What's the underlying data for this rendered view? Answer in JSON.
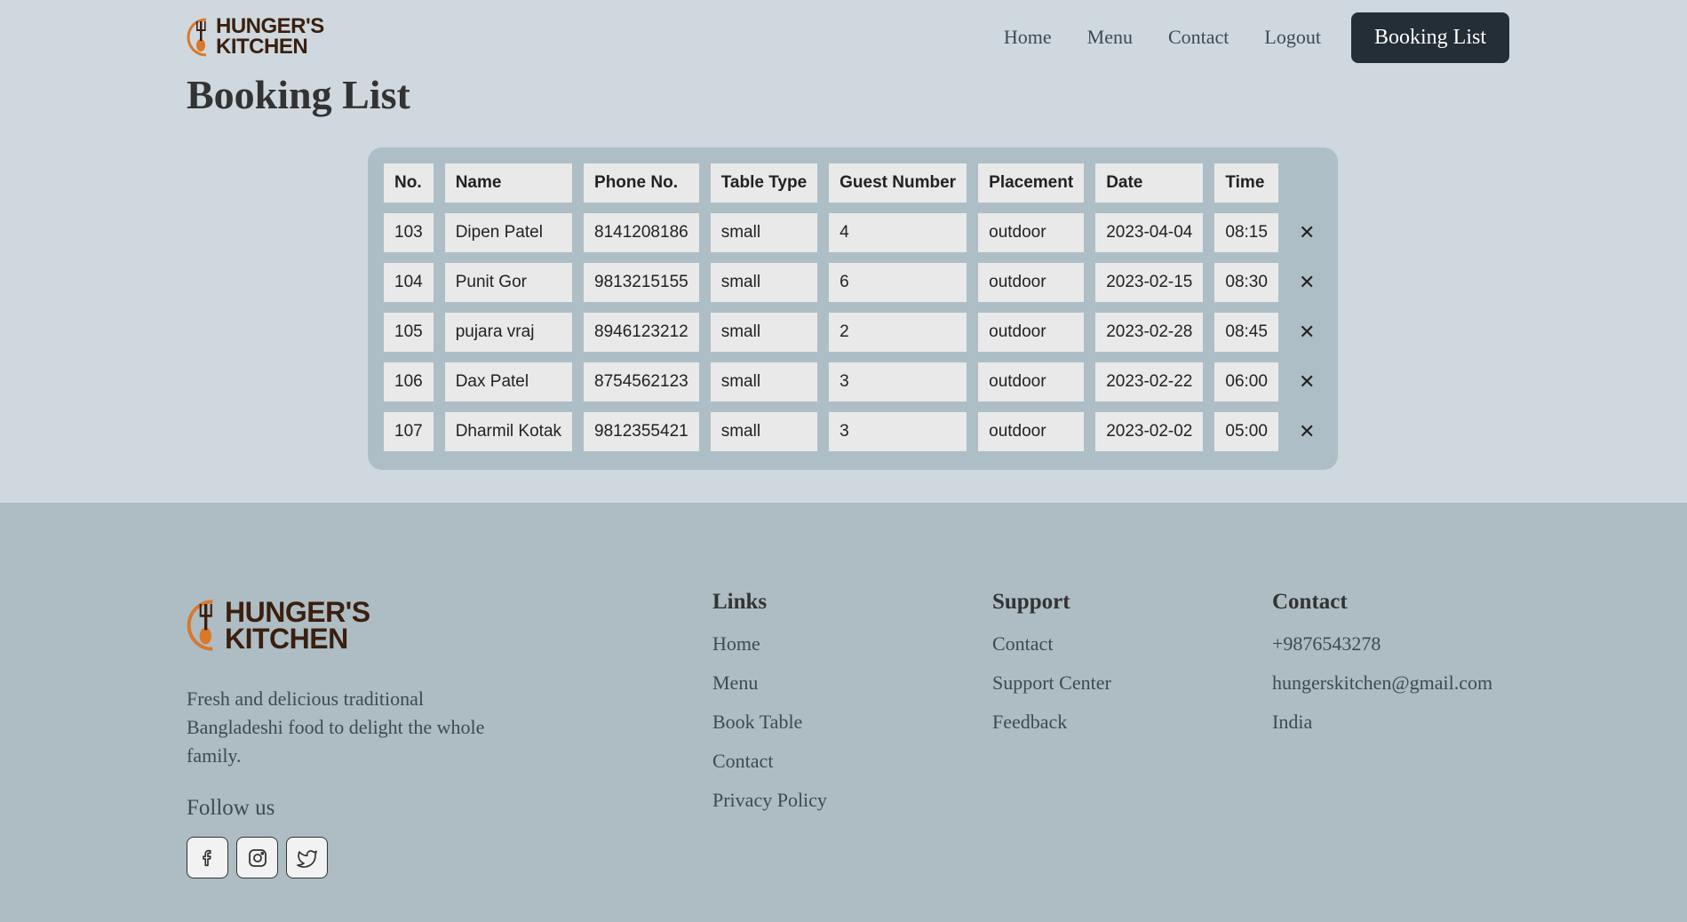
{
  "brand": {
    "line1": "HUNGER'S",
    "line2": "KITCHEN"
  },
  "nav": {
    "items": [
      "Home",
      "Menu",
      "Contact",
      "Logout"
    ],
    "active": "Booking List"
  },
  "page_title": "Booking List",
  "table": {
    "headers": [
      "No.",
      "Name",
      "Phone No.",
      "Table Type",
      "Guest Number",
      "Placement",
      "Date",
      "Time"
    ],
    "rows": [
      [
        "103",
        "Dipen Patel",
        "8141208186",
        "small",
        "4",
        "outdoor",
        "2023-04-04",
        "08:15"
      ],
      [
        "104",
        "Punit Gor",
        "9813215155",
        "small",
        "6",
        "outdoor",
        "2023-02-15",
        "08:30"
      ],
      [
        "105",
        "pujara vraj",
        "8946123212",
        "small",
        "2",
        "outdoor",
        "2023-02-28",
        "08:45"
      ],
      [
        "106",
        "Dax Patel",
        "8754562123",
        "small",
        "3",
        "outdoor",
        "2023-02-22",
        "06:00"
      ],
      [
        "107",
        "Dharmil Kotak",
        "9812355421",
        "small",
        "3",
        "outdoor",
        "2023-02-02",
        "05:00"
      ]
    ],
    "delete_glyph": "✕"
  },
  "footer": {
    "description": "Fresh and delicious traditional Bangladeshi food to delight the whole family.",
    "follow_label": "Follow us",
    "socials": [
      "facebook-icon",
      "instagram-icon",
      "twitter-icon"
    ],
    "links": {
      "title": "Links",
      "items": [
        "Home",
        "Menu",
        "Book Table",
        "Contact",
        "Privacy Policy"
      ]
    },
    "support": {
      "title": "Support",
      "items": [
        "Contact",
        "Support Center",
        "Feedback"
      ]
    },
    "contact": {
      "title": "Contact",
      "items": [
        "+9876543278",
        "hungerskitchen@gmail.com",
        "India"
      ]
    }
  },
  "colors": {
    "page_bg": "#cfd8de",
    "footer_bg": "#aebdc4",
    "panel_bg": "#aebec6",
    "cell_bg": "#e9e9e9",
    "active_button": "#232e36",
    "logo_brown": "#3a1f0f",
    "logo_orange": "#d9782b"
  }
}
